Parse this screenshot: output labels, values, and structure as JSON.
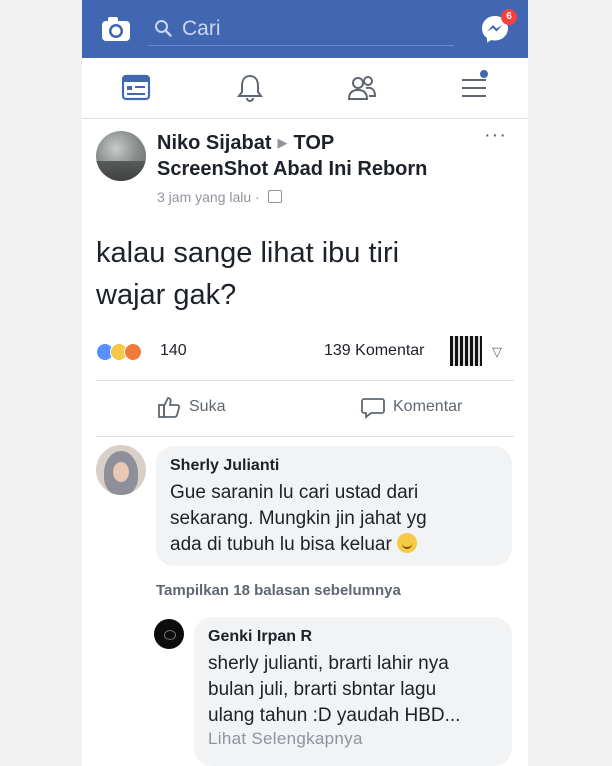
{
  "header": {
    "search_placeholder": "Cari",
    "messenger_badge": "6",
    "colors": {
      "brand": "#4267b2",
      "badge": "#fa3e3e"
    }
  },
  "nav": {
    "items": [
      {
        "icon": "news-feed-icon",
        "active": true
      },
      {
        "icon": "bell-icon",
        "active": false
      },
      {
        "icon": "friends-icon",
        "active": false
      },
      {
        "icon": "menu-icon",
        "active": false,
        "dot": true
      }
    ]
  },
  "post": {
    "author": "Niko Sijabat",
    "group": "TOP ScreenShot Abad Ini Reborn",
    "time": "3 jam yang lalu",
    "text_line1": "kalau sange lihat ibu tiri",
    "text_line2": "wajar gak?",
    "reaction_count": "140",
    "comment_count": "139 Komentar",
    "like_label": "Suka",
    "comment_label": "Komentar"
  },
  "comments": [
    {
      "name": "Sherly Julianti",
      "line1": "Gue saranin lu cari ustad dari",
      "line2": "sekarang. Mungkin jin jahat yg",
      "line3": "ada di tubuh lu bisa keluar"
    }
  ],
  "previous_replies": "Tampilkan 18 balasan sebelumnya",
  "reply": {
    "name": "Genki Irpan R",
    "line1": "sherly julianti, brarti lahir nya",
    "line2": "bulan juli, brarti sbntar lagu",
    "line3": "ulang tahun :D yaudah HBD...",
    "see_more": "Lihat Selengkapnya"
  }
}
